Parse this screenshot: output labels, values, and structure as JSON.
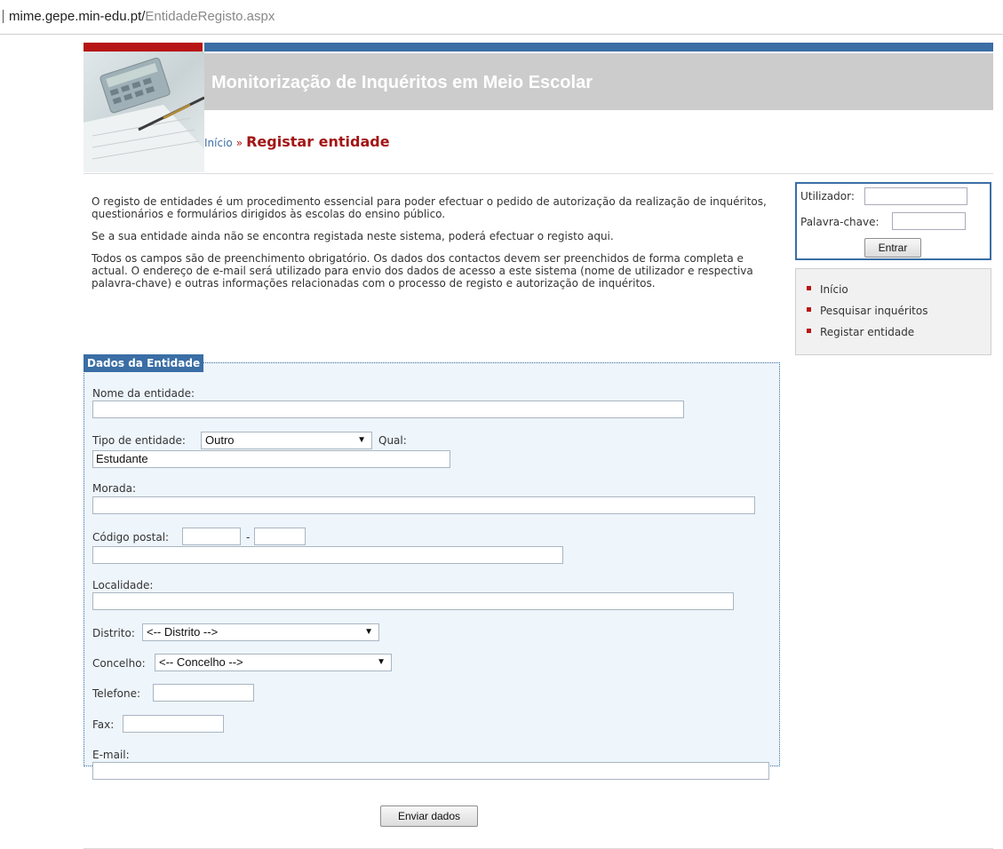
{
  "browser": {
    "url_host": "mime.gepe.min-edu.pt/",
    "url_path": "EntidadeRegisto.aspx"
  },
  "header": {
    "title": "Monitorização de Inquéritos em Meio Escolar"
  },
  "breadcrumb": {
    "home": "Início",
    "separator": "»",
    "current": "Registar entidade"
  },
  "intro": {
    "p1": "O registo de entidades é um procedimento essencial para poder efectuar o pedido de autorização da realização de inquéritos, questionários e formulários dirigidos às escolas do ensino público.",
    "p2": "Se a sua entidade ainda não se encontra registada neste sistema, poderá efectuar o registo aqui.",
    "p3": "Todos os campos são de preenchimento obrigatório. Os dados dos contactos devem ser preenchidos de forma completa e actual. O endereço de e-mail será utilizado para envio dos dados de acesso a este sistema (nome de utilizador e respectiva palavra-chave) e outras informações relacionadas com o processo de registo e autorização de inquéritos."
  },
  "login": {
    "user_label": "Utilizador:",
    "user_value": "",
    "password_label": "Palavra-chave:",
    "password_value": "",
    "button": "Entrar"
  },
  "nav": {
    "items": [
      "Início",
      "Pesquisar inquéritos",
      "Registar entidade"
    ]
  },
  "form": {
    "legend": "Dados da Entidade",
    "nome_label": "Nome da entidade:",
    "nome_value": "",
    "tipo_label": "Tipo de entidade:",
    "tipo_value": "Outro",
    "qual_label": "Qual:",
    "qual_value": "Estudante",
    "morada_label": "Morada:",
    "morada_value": "",
    "cp_label": "Código postal:",
    "cp_dash": "-",
    "cp1_value": "",
    "cp2_value": "",
    "cp_locality_value": "",
    "localidade_label": "Localidade:",
    "localidade_value": "",
    "distrito_label": "Distrito:",
    "distrito_value": "<-- Distrito -->",
    "concelho_label": "Concelho:",
    "concelho_value": "<-- Concelho -->",
    "telefone_label": "Telefone:",
    "telefone_value": "",
    "fax_label": "Fax:",
    "fax_value": "",
    "email_label": "E-mail:",
    "email_value": "",
    "submit": "Enviar dados"
  },
  "colors": {
    "brand_red": "#b71515",
    "brand_blue": "#3a6ea5",
    "title_band": "#cccccc",
    "form_bg": "#eef5fb"
  }
}
